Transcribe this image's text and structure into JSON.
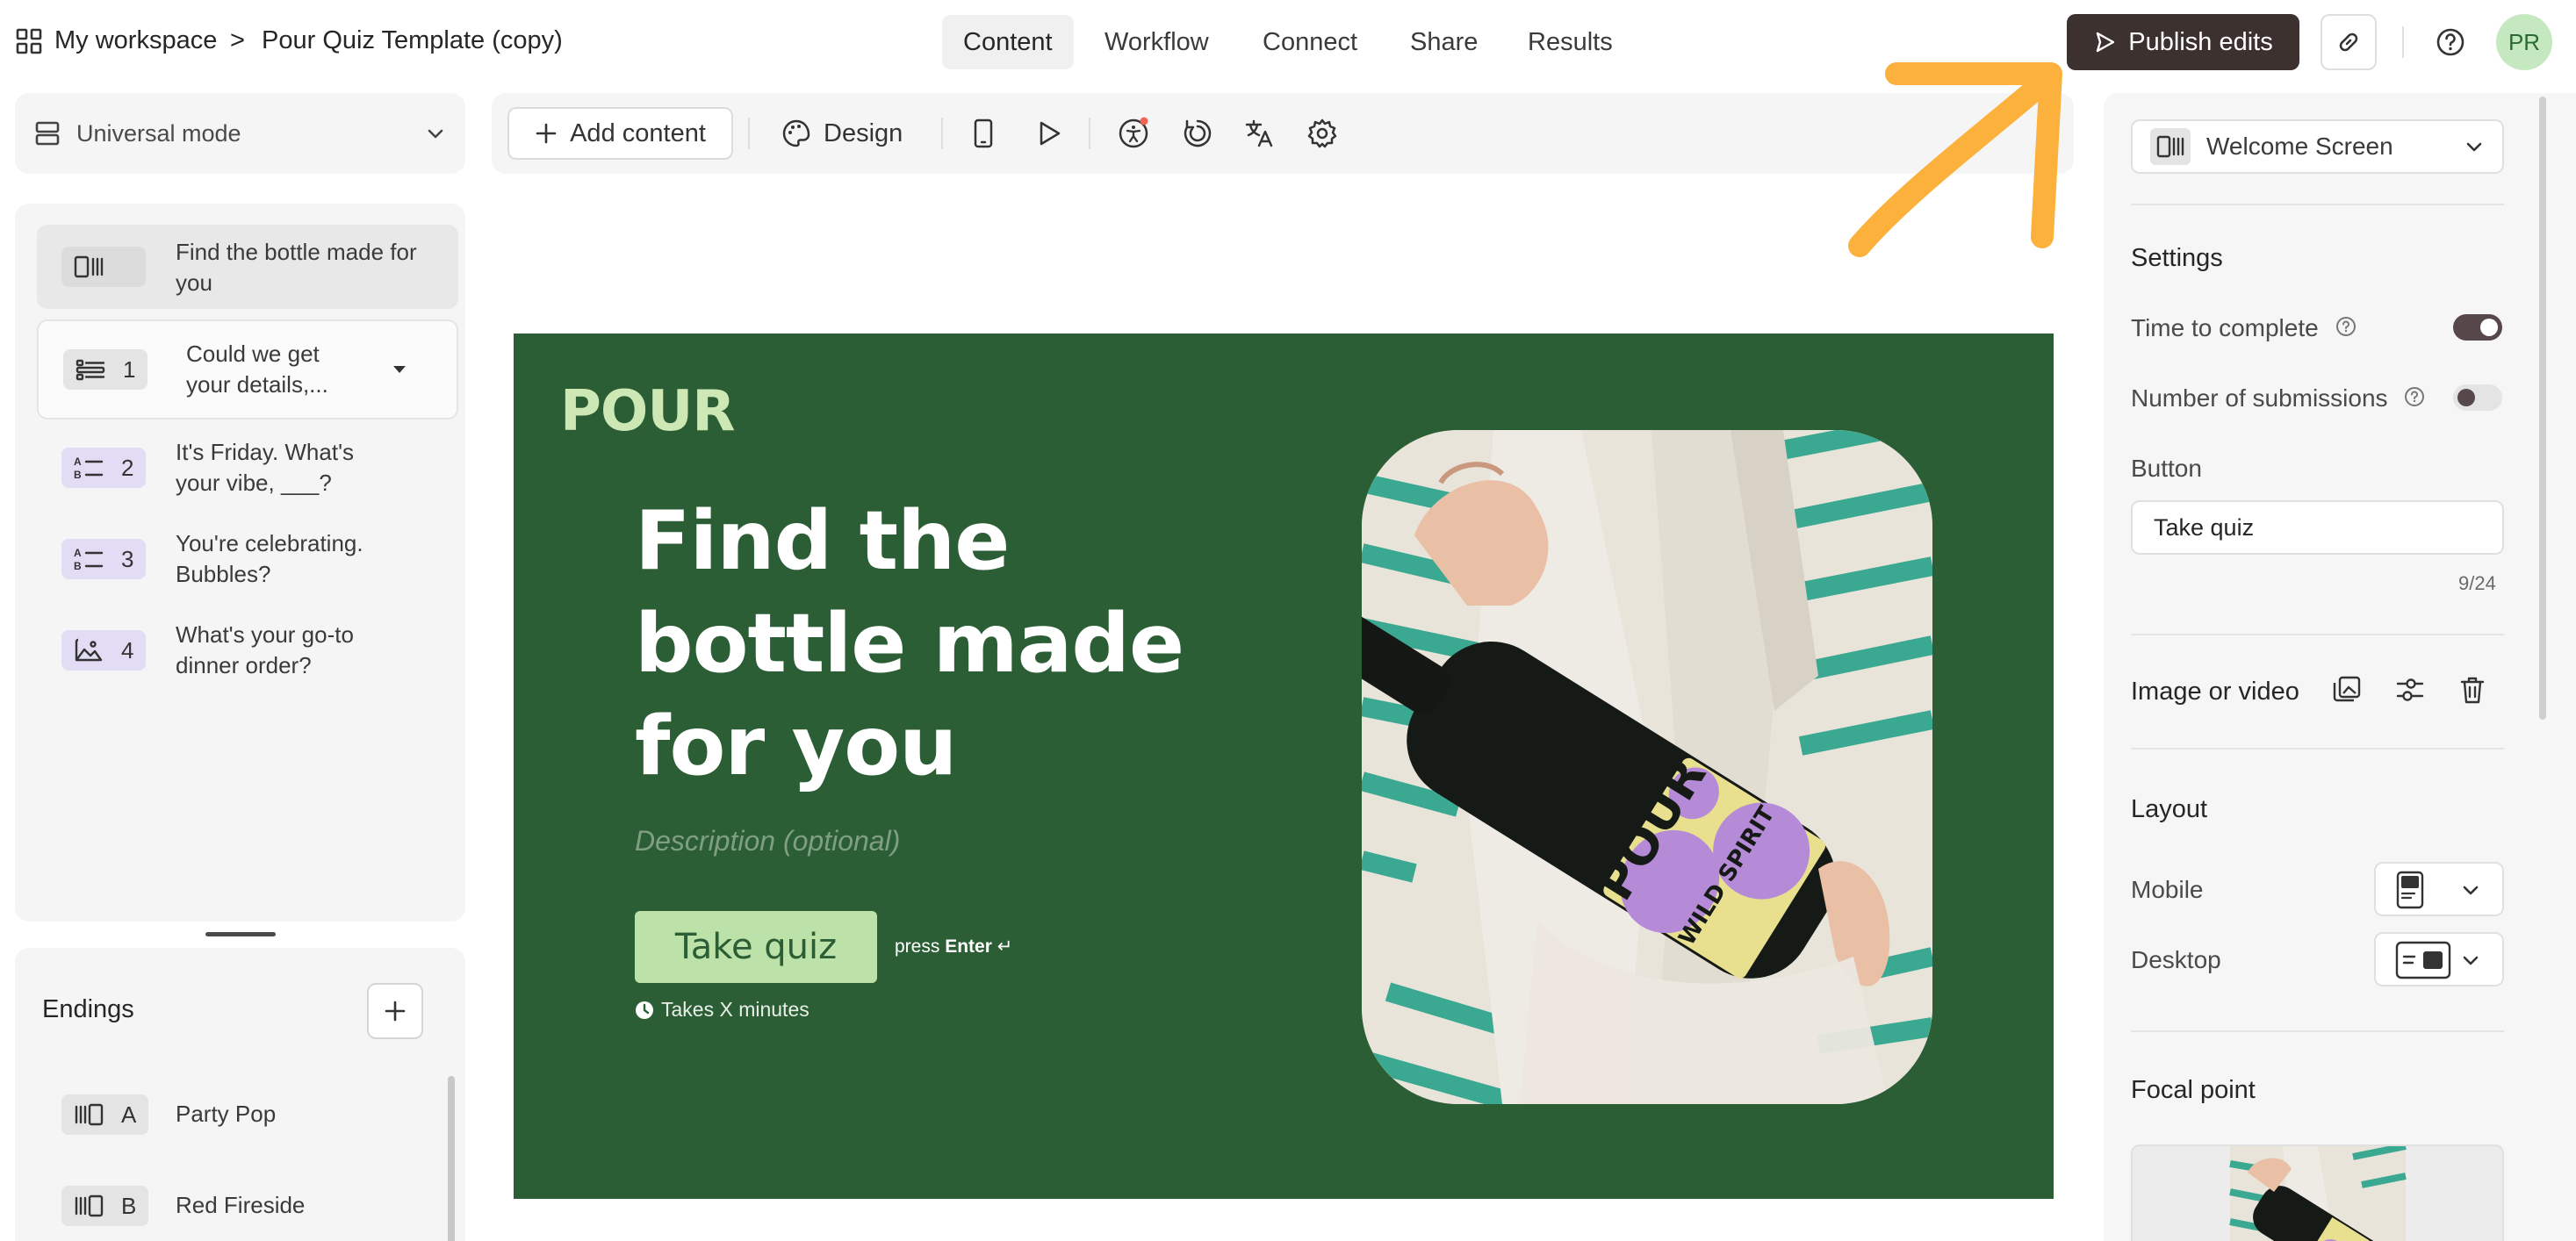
{
  "header": {
    "workspace": "My workspace",
    "separator": ">",
    "form_title": "Pour Quiz Template (copy)",
    "tabs": [
      {
        "label": "Content",
        "active": true
      },
      {
        "label": "Workflow",
        "active": false
      },
      {
        "label": "Connect",
        "active": false
      },
      {
        "label": "Share",
        "active": false
      },
      {
        "label": "Results",
        "active": false
      }
    ],
    "publish_label": "Publish edits",
    "avatar_initials": "PR"
  },
  "sidebar": {
    "mode_label": "Universal mode",
    "questions": [
      {
        "badge": "",
        "icon": "welcome-screen-icon",
        "label": "Find the bottle made for you",
        "selected": true
      },
      {
        "badge": "1",
        "icon": "contact-form-icon",
        "label": "Could we get your details,...",
        "selected": false
      },
      {
        "badge": "2",
        "icon": "multiple-choice-icon",
        "label": "It's Friday. What's your vibe, ___?",
        "selected": false
      },
      {
        "badge": "3",
        "icon": "multiple-choice-icon",
        "label": "You're celebrating. Bubbles?",
        "selected": false
      },
      {
        "badge": "4",
        "icon": "picture-choice-icon",
        "label": "What's your go-to dinner order?",
        "selected": false
      }
    ],
    "endings_title": "Endings",
    "endings": [
      {
        "badge": "A",
        "label": "Party Pop"
      },
      {
        "badge": "B",
        "label": "Red Fireside"
      }
    ]
  },
  "toolbar": {
    "add_content_label": "Add content",
    "design_label": "Design"
  },
  "canvas": {
    "brand": "POUR",
    "headline": "Find the bottle made for you",
    "description_placeholder": "Description (optional)",
    "cta_label": "Take quiz",
    "press_prefix": "press",
    "press_key": "Enter",
    "enter_symbol": "↵",
    "time_hint": "Takes X minutes",
    "bottle_label": "POUR",
    "bottle_sublabel": "WILD SPIRIT"
  },
  "right_panel": {
    "screen_type": "Welcome Screen",
    "settings_title": "Settings",
    "time_to_complete_label": "Time to complete",
    "time_to_complete_on": true,
    "submissions_label": "Number of submissions",
    "submissions_on": false,
    "button_title": "Button",
    "button_value": "Take quiz",
    "button_counter": "9/24",
    "image_title": "Image or video",
    "layout_title": "Layout",
    "mobile_label": "Mobile",
    "desktop_label": "Desktop",
    "focal_title": "Focal point"
  },
  "colors": {
    "canvas_bg": "#2c5e35",
    "brand_green": "#cde8b5",
    "cta_bg": "#bde2a9",
    "publish_bg": "#3d3130",
    "arrow_annotation": "#fbb13c",
    "bottle_purple": "#b58bd8"
  }
}
